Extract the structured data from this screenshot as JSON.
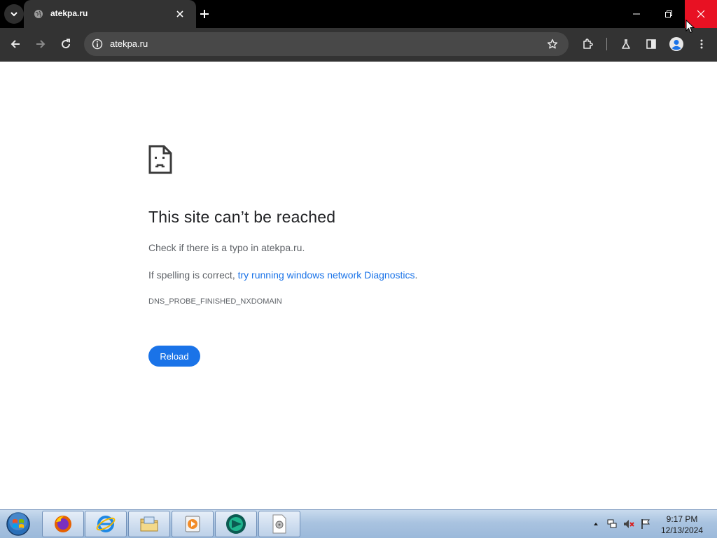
{
  "browser": {
    "tab": {
      "title": "atekpa.ru",
      "favicon": "globe-icon"
    },
    "omnibox": {
      "url": "atekpa.ru"
    }
  },
  "error_page": {
    "title": "This site can’t be reached",
    "line1": "Check if there is a typo in atekpa.ru.",
    "line2_prefix": "If spelling is correct, ",
    "line2_link": "try running windows network Diagnostics",
    "line2_suffix": ".",
    "error_code": "DNS_PROBE_FINISHED_NXDOMAIN",
    "reload_label": "Reload"
  },
  "taskbar": {
    "apps": [
      "firefox-icon",
      "internet-explorer-icon",
      "file-explorer-icon",
      "media-player-icon",
      "app-icon",
      "document-icon"
    ],
    "clock": {
      "time": "9:17 PM",
      "date": "12/13/2024"
    }
  },
  "colors": {
    "accent": "#1a73e8",
    "tab_active": "#333333",
    "close_hover": "#e81123"
  }
}
